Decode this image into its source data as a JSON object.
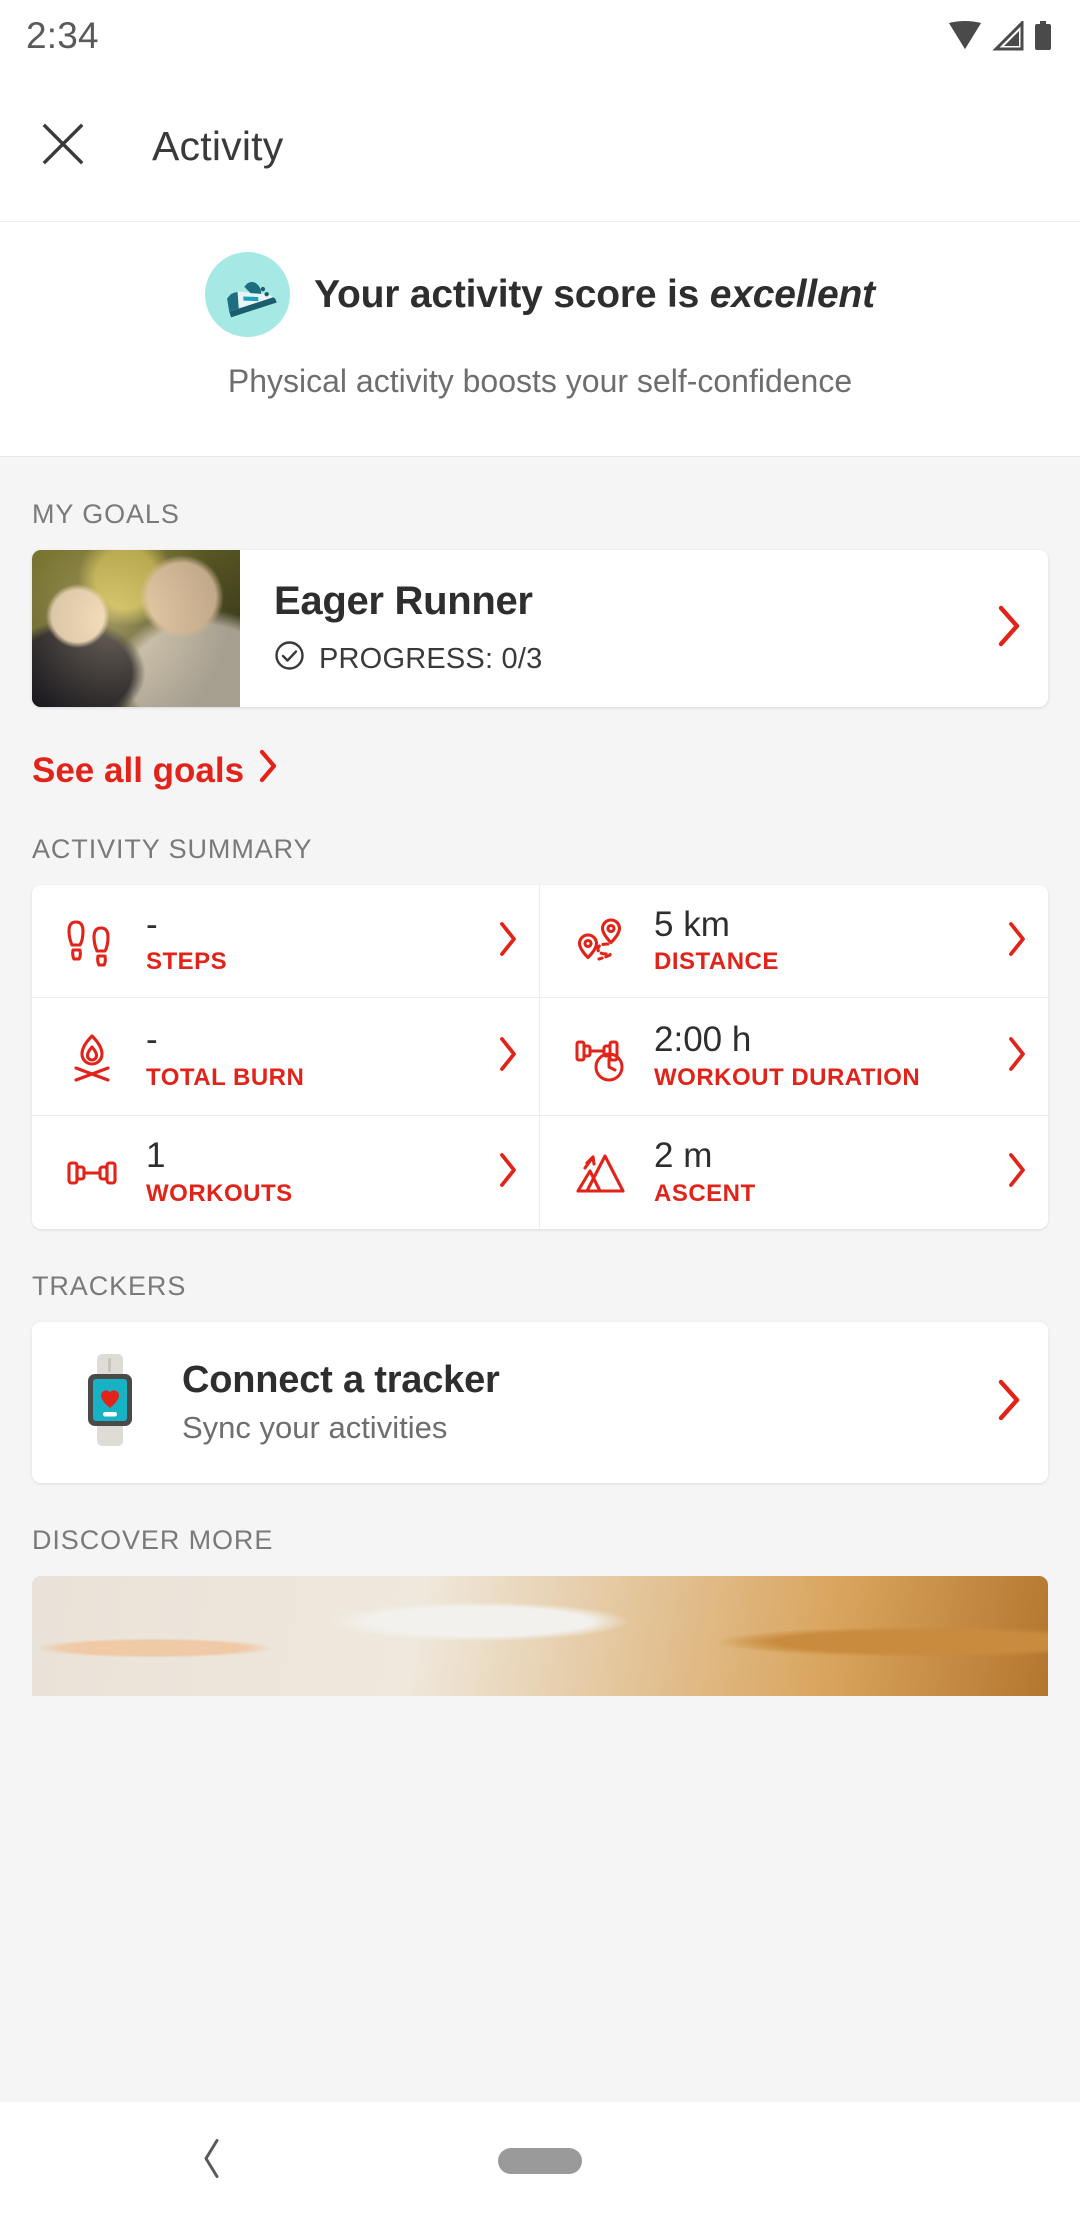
{
  "colors": {
    "accent": "#E2231A",
    "badge_teal": "#A6E9E4",
    "tracker_cyan": "#17B3C4",
    "page_bg": "#F5F5F5"
  },
  "status_bar": {
    "time": "2:34",
    "icons": [
      {
        "name": "wifi-icon"
      },
      {
        "name": "cellular-signal-icon"
      },
      {
        "name": "battery-icon"
      }
    ]
  },
  "app_bar": {
    "close_label": "✕",
    "title": "Activity"
  },
  "hero": {
    "icon_name": "running-shoe-icon",
    "title_prefix": "Your activity score is ",
    "title_emphasis": "excellent",
    "subtitle": "Physical activity boosts your self-confidence"
  },
  "my_goals": {
    "section_label": "MY GOALS",
    "goal": {
      "image_name": "runners-photo",
      "title": "Eager Runner",
      "progress_icon": "check-circle-icon",
      "progress": "PROGRESS: 0/3",
      "chevron": "chevron-right-icon"
    },
    "see_all_label": "See all goals"
  },
  "activity_summary": {
    "section_label": "ACTIVITY SUMMARY",
    "cells": [
      {
        "icon": "footprints-icon",
        "value": "-",
        "label": "STEPS"
      },
      {
        "icon": "route-pins-icon",
        "value": "5 km",
        "label": "DISTANCE"
      },
      {
        "icon": "campfire-icon",
        "value": "-",
        "label": "TOTAL BURN"
      },
      {
        "icon": "dumbbell-clock-icon",
        "value": "2:00 h",
        "label": "WORKOUT DURATION"
      },
      {
        "icon": "dumbbell-icon",
        "value": "1",
        "label": "WORKOUTS"
      },
      {
        "icon": "mountains-icon",
        "value": "2 m",
        "label": "ASCENT"
      }
    ]
  },
  "trackers": {
    "section_label": "TRACKERS",
    "card": {
      "icon": "smartwatch-heart-icon",
      "title": "Connect a tracker",
      "subtitle": "Sync your activities",
      "chevron": "chevron-right-icon"
    }
  },
  "discover_more": {
    "section_label": "DISCOVER MORE",
    "card_image_name": "woman-drinking-water-photo"
  },
  "nav_bar": {
    "back": "back-icon",
    "home": "home-pill"
  }
}
